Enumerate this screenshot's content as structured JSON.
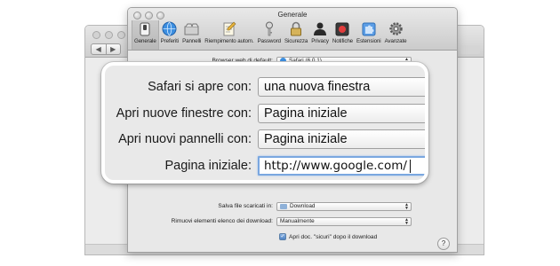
{
  "window": {
    "title": "Generale"
  },
  "background_window": {
    "nav_back": "◀",
    "nav_forward": "▶"
  },
  "toolbar": {
    "tabs": [
      {
        "label": "Generale",
        "icon": "general-switch-icon",
        "active": true
      },
      {
        "label": "Preferiti",
        "icon": "globe-icon",
        "active": false
      },
      {
        "label": "Pannelli",
        "icon": "tabs-icon",
        "active": false
      },
      {
        "label": "Riempimento autom.",
        "icon": "pencil-form-icon",
        "active": false
      },
      {
        "label": "Password",
        "icon": "key-icon",
        "active": false
      },
      {
        "label": "Sicurezza",
        "icon": "lock-icon",
        "active": false
      },
      {
        "label": "Privacy",
        "icon": "silhouette-icon",
        "active": false
      },
      {
        "label": "Notifiche",
        "icon": "notification-icon",
        "active": false
      },
      {
        "label": "Estensioni",
        "icon": "puzzle-icon",
        "active": false
      },
      {
        "label": "Avanzate",
        "icon": "gear-icon",
        "active": false
      }
    ]
  },
  "general": {
    "default_browser_label": "Browser web di default:",
    "default_browser_value": "Safari (6.0.1)",
    "download_folder_label": "Salva file scaricati in:",
    "download_folder_value": "Download",
    "remove_downloads_label": "Rimuovi elementi elenco dei download:",
    "remove_downloads_value": "Manualmente",
    "open_safe_files_label": "Apri doc. \"sicuri\" dopo il download",
    "open_safe_files_checked": true,
    "checkbox_mark": "✓",
    "help_label": "?"
  },
  "callout": {
    "rows": [
      {
        "label": "Safari si apre con:",
        "value": "una nuova finestra"
      },
      {
        "label": "Apri nuove finestre con:",
        "value": "Pagina iniziale"
      },
      {
        "label": "Apri nuovi pannelli con:",
        "value": "Pagina iniziale"
      }
    ],
    "homepage_label": "Pagina iniziale:",
    "homepage_value": "http://www.google.com/"
  },
  "colors": {
    "accent": "#4f83c4",
    "focus_ring": "#7aa7e0"
  }
}
